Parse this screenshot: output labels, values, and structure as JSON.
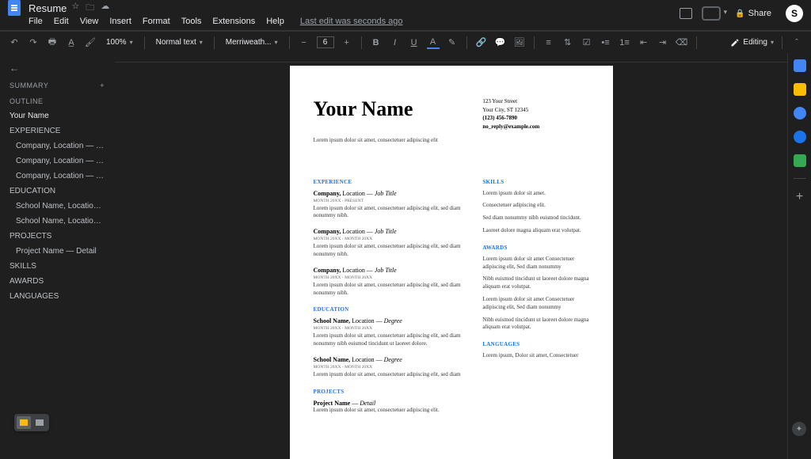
{
  "docTitle": "Resume",
  "menus": [
    "File",
    "Edit",
    "View",
    "Insert",
    "Format",
    "Tools",
    "Extensions",
    "Help"
  ],
  "lastEdit": "Last edit was seconds ago",
  "shareLabel": "Share",
  "avatarInitial": "S",
  "toolbar": {
    "zoom": "100%",
    "style": "Normal text",
    "font": "Merriweath...",
    "size": "6",
    "editing": "Editing"
  },
  "outline": {
    "summary": "SUMMARY",
    "outlineLabel": "OUTLINE",
    "items": [
      {
        "label": "Your Name",
        "bold": true,
        "sub": false
      },
      {
        "label": "EXPERIENCE",
        "bold": false,
        "sub": false
      },
      {
        "label": "Company, Location — Job Title",
        "bold": false,
        "sub": true
      },
      {
        "label": "Company, Location — Job Title",
        "bold": false,
        "sub": true
      },
      {
        "label": "Company, Location — Job Title",
        "bold": false,
        "sub": true
      },
      {
        "label": "EDUCATION",
        "bold": false,
        "sub": false
      },
      {
        "label": "School Name, Location — Degr...",
        "bold": false,
        "sub": true
      },
      {
        "label": "School Name, Location — Degr...",
        "bold": false,
        "sub": true
      },
      {
        "label": "PROJECTS",
        "bold": false,
        "sub": false
      },
      {
        "label": "Project Name — Detail",
        "bold": false,
        "sub": true
      },
      {
        "label": "SKILLS",
        "bold": false,
        "sub": false
      },
      {
        "label": "AWARDS",
        "bold": false,
        "sub": false
      },
      {
        "label": "LANGUAGES",
        "bold": false,
        "sub": false
      }
    ]
  },
  "doc": {
    "name": "Your Name",
    "tagline": "Lorem ipsum dolor sit amet, consectetuer adipiscing elit",
    "contact": {
      "street": "123 Your Street",
      "city": "Your City, ST 12345",
      "phone": "(123) 456-7890",
      "email": "no_reply@example.com"
    },
    "sections": {
      "experience": "EXPERIENCE",
      "education": "EDUCATION",
      "projects": "PROJECTS",
      "skills": "SKILLS",
      "awards": "AWARDS",
      "languages": "LANGUAGES"
    },
    "exp": [
      {
        "company": "Company,",
        "loc": " Location ",
        "dash": "— ",
        "title": "Job Title",
        "date": "MONTH 20XX - PRESENT",
        "body": "Lorem ipsum dolor sit amet, consectetuer adipiscing elit, sed diam nonummy nibh."
      },
      {
        "company": "Company,",
        "loc": " Location ",
        "dash": "— ",
        "title": "Job Title",
        "date": "MONTH 20XX - MONTH 20XX",
        "body": "Lorem ipsum dolor sit amet, consectetuer adipiscing elit, sed diam nonummy nibh."
      },
      {
        "company": "Company,",
        "loc": " Location ",
        "dash": "— ",
        "title": "Job Title",
        "date": "MONTH 20XX - MONTH 20XX",
        "body": "Lorem ipsum dolor sit amet, consectetuer adipiscing elit, sed diam nonummy nibh."
      }
    ],
    "edu": [
      {
        "school": "School Name,",
        "loc": " Location ",
        "dash": "— ",
        "deg": "Degree",
        "date": "MONTH 20XX - MONTH 20XX",
        "body": "Lorem ipsum dolor sit amet, consectetuer adipiscing elit, sed diam nonummy nibh euismod tincidunt ut laoreet dolore."
      },
      {
        "school": "School Name,",
        "loc": " Location ",
        "dash": "— ",
        "deg": "Degree",
        "date": "MONTH 20XX - MONTH 20XX",
        "body": "Lorem ipsum dolor sit amet, consectetuer adipiscing elit, sed diam"
      }
    ],
    "projects": [
      {
        "name": "Project Name",
        "dash": " — ",
        "detail": "Detail",
        "body": "Lorem ipsum dolor sit amet, consectetuer adipiscing elit."
      }
    ],
    "skills": [
      "Lorem ipsum dolor sit amet.",
      "Consectetuer adipiscing elit.",
      "Sed diam nonummy nibh euismod tincidunt.",
      "Laoreet dolore magna aliquam erat volutpat."
    ],
    "awards": [
      "Lorem ipsum dolor sit amet Consectetuer adipiscing elit, Sed diam nonummy",
      "Nibh euismod tincidunt ut laoreet dolore magna aliquam erat volutpat.",
      "Lorem ipsum dolor sit amet Consectetuer adipiscing elit, Sed diam nonummy",
      "Nibh euismod tincidunt ut laoreet dolore magna aliquam erat volutpat."
    ],
    "languages": "Lorem ipsum, Dolor sit amet, Consectetuer"
  }
}
